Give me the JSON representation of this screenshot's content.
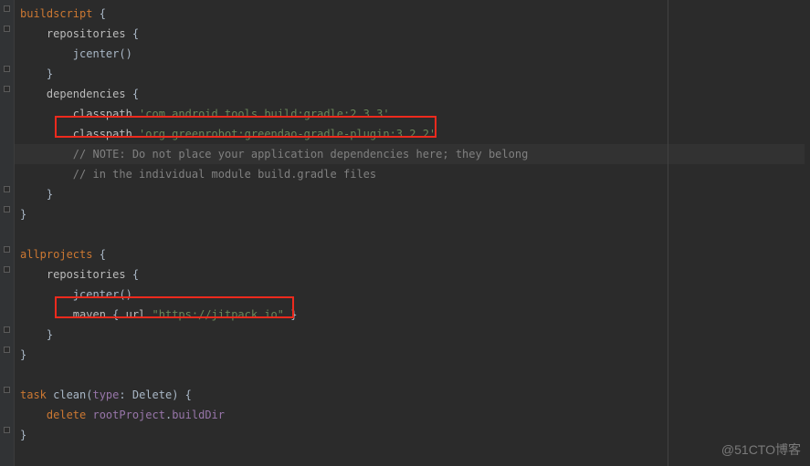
{
  "code": {
    "l1_kw": "buildscript",
    "l1_brace": " {",
    "l2_ident": "    repositories",
    "l2_brace": " {",
    "l3": "        jcenter()",
    "l4": "    }",
    "l5_ident": "    dependencies",
    "l5_brace": " {",
    "l6_kw": "        classpath ",
    "l6_str": "'com.android.tools.build:gradle:2.3.3'",
    "l7_kw": "        classpath ",
    "l7_str": "'org.greenrobot:greendao-gradle-plugin:3.2.2'",
    "l8_comment": "        // NOTE: Do not place your application dependencies here; they belong",
    "l9_comment": "        // in the individual module build.gradle files",
    "l10": "    }",
    "l11": "}",
    "l12": "",
    "l13_kw": "allprojects",
    "l13_brace": " {",
    "l14_ident": "    repositories",
    "l14_brace": " {",
    "l15": "        jcenter()",
    "l16_kw": "        maven ",
    "l16_brace1": "{ ",
    "l16_ident": "url ",
    "l16_str": "\"https://jitpack.io\"",
    "l16_brace2": " }",
    "l17": "    }",
    "l18": "}",
    "l19": "",
    "l20_kw1": "task",
    "l20_ident": " clean(",
    "l20_type": "type",
    "l20_rest": ": Delete) {",
    "l21_kw": "    delete ",
    "l21_p1": "rootProject",
    "l21_dot": ".",
    "l21_p2": "buildDir",
    "l22": "}"
  },
  "watermark": "@51CTO博客"
}
